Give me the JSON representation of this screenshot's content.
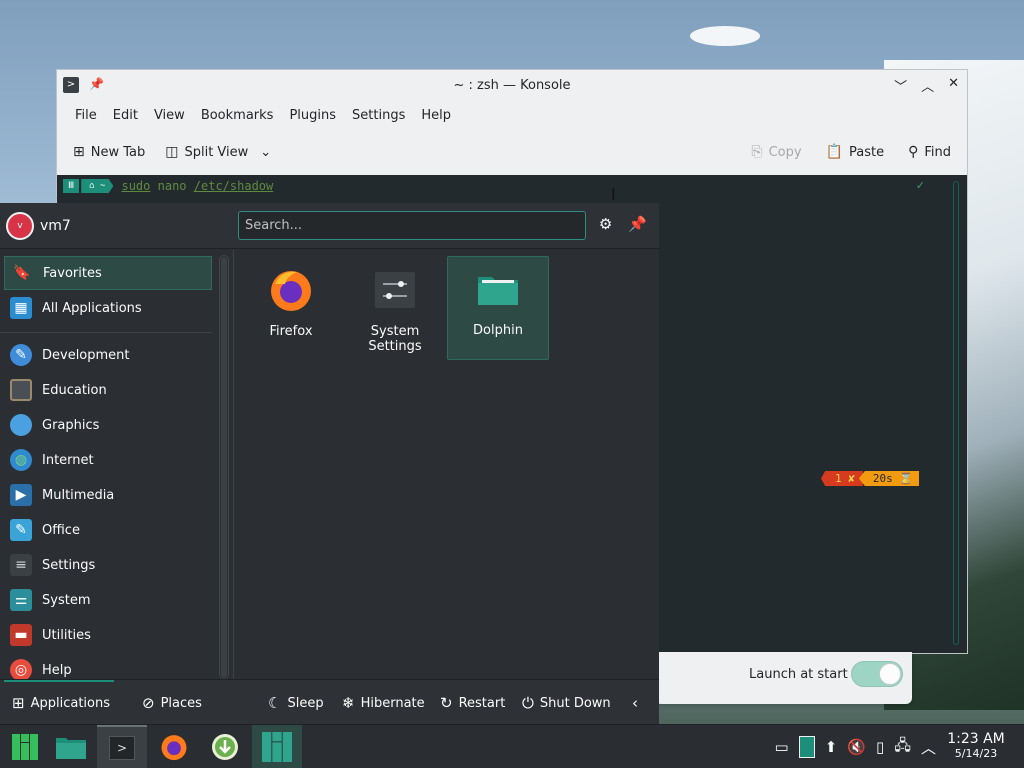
{
  "konsole": {
    "title": "~ : zsh — Konsole",
    "menu": [
      "File",
      "Edit",
      "View",
      "Bookmarks",
      "Plugins",
      "Settings",
      "Help"
    ],
    "toolbar": {
      "new_tab": "New Tab",
      "split_view": "Split View",
      "copy": "Copy",
      "paste": "Paste",
      "find": "Find"
    },
    "terminal": {
      "prompt_seg1": "Ⅲ",
      "prompt_seg2": "⌂ ~",
      "cmd_sudo": "sudo",
      "cmd_nano": "nano",
      "cmd_path": "/etc/shadow",
      "status_err": "1 ✘",
      "status_dur": "20s ⌛",
      "check": "✓"
    }
  },
  "welcome": {
    "launch_label": "Launch at start",
    "launch_enabled": true
  },
  "launcher": {
    "avatar_initial": "v",
    "username": "vm7",
    "search_placeholder": "Search...",
    "sidebar": [
      {
        "label": "Favorites",
        "icon": "bookmark-icon"
      },
      {
        "label": "All Applications",
        "icon": "grid-icon"
      },
      {
        "label": "Development",
        "icon": "development-icon"
      },
      {
        "label": "Education",
        "icon": "education-icon"
      },
      {
        "label": "Graphics",
        "icon": "graphics-icon"
      },
      {
        "label": "Internet",
        "icon": "globe-icon"
      },
      {
        "label": "Multimedia",
        "icon": "multimedia-icon"
      },
      {
        "label": "Office",
        "icon": "office-icon"
      },
      {
        "label": "Settings",
        "icon": "settings-icon"
      },
      {
        "label": "System",
        "icon": "system-icon"
      },
      {
        "label": "Utilities",
        "icon": "utilities-icon"
      },
      {
        "label": "Help",
        "icon": "help-icon"
      }
    ],
    "favorites": [
      {
        "label": "Firefox",
        "icon": "firefox-icon"
      },
      {
        "label": "System Settings",
        "icon": "system-settings-icon"
      },
      {
        "label": "Dolphin",
        "icon": "dolphin-folder-icon"
      }
    ],
    "footer": {
      "applications": "Applications",
      "places": "Places",
      "sleep": "Sleep",
      "hibernate": "Hibernate",
      "restart": "Restart",
      "shutdown": "Shut Down"
    }
  },
  "taskbar": {
    "time": "1:23 AM",
    "date": "5/14/23"
  },
  "colors": {
    "accent": "#1c8e7a",
    "panel_bg": "#2b2e32",
    "terminal_bg": "#232a2e",
    "error_segment": "#d63b1f",
    "duration_segment": "#f29b11"
  }
}
